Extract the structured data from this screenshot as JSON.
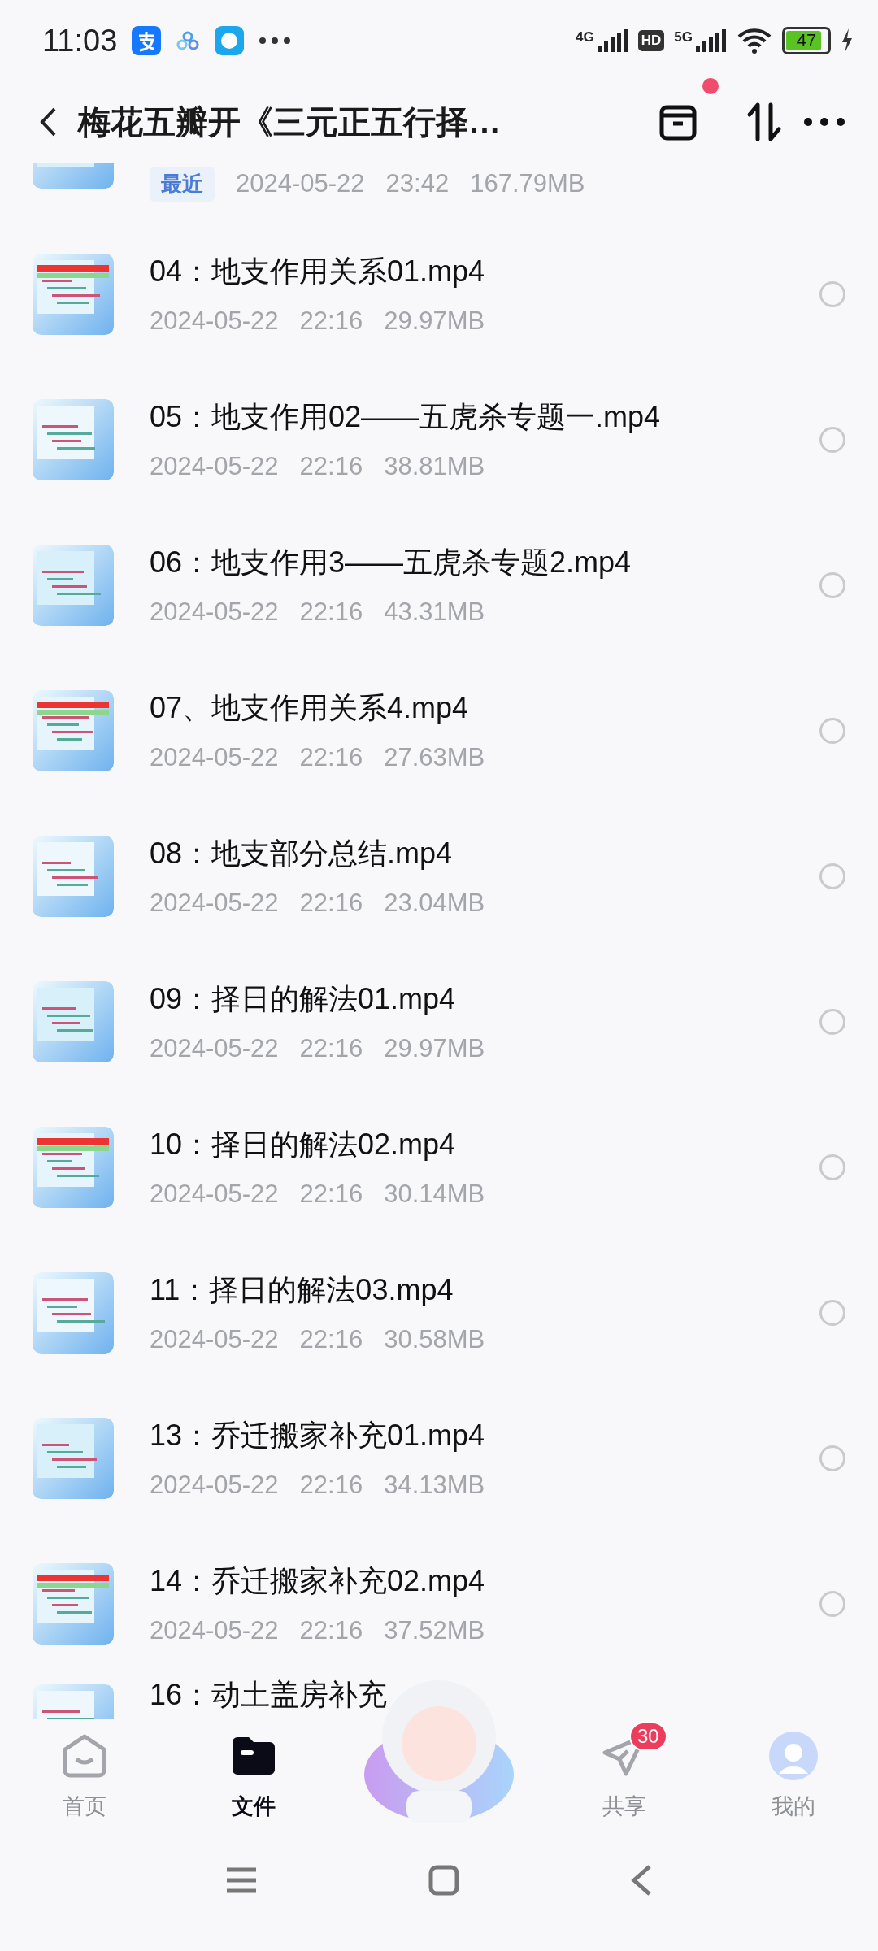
{
  "status_bar": {
    "time": "11:03",
    "network_1": "4G",
    "hd": "HD",
    "network_2": "5G",
    "battery": "47"
  },
  "header": {
    "title": "梅花五瓣开《三元正五行择…",
    "archive_badge": true
  },
  "files": [
    {
      "kind": "partial",
      "tag": "最近",
      "date": "2024-05-22",
      "time": "23:42",
      "size": "167.79MB"
    },
    {
      "kind": "file",
      "name": "04：地支作用关系01.mp4",
      "date": "2024-05-22",
      "time": "22:16",
      "size": "29.97MB",
      "selected": false
    },
    {
      "kind": "file",
      "name": "05：地支作用02——五虎杀专题一.mp4",
      "date": "2024-05-22",
      "time": "22:16",
      "size": "38.81MB",
      "selected": false
    },
    {
      "kind": "file",
      "name": "06：地支作用3——五虎杀专题2.mp4",
      "date": "2024-05-22",
      "time": "22:16",
      "size": "43.31MB",
      "selected": false
    },
    {
      "kind": "file",
      "name": "07、地支作用关系4.mp4",
      "date": "2024-05-22",
      "time": "22:16",
      "size": "27.63MB",
      "selected": false
    },
    {
      "kind": "file",
      "name": "08：地支部分总结.mp4",
      "date": "2024-05-22",
      "time": "22:16",
      "size": "23.04MB",
      "selected": false
    },
    {
      "kind": "file",
      "name": "09：择日的解法01.mp4",
      "date": "2024-05-22",
      "time": "22:16",
      "size": "29.97MB",
      "selected": false
    },
    {
      "kind": "file",
      "name": "10：择日的解法02.mp4",
      "date": "2024-05-22",
      "time": "22:16",
      "size": "30.14MB",
      "selected": false
    },
    {
      "kind": "file",
      "name": "11：择日的解法03.mp4",
      "date": "2024-05-22",
      "time": "22:16",
      "size": "30.58MB",
      "selected": false
    },
    {
      "kind": "file",
      "name": "13：乔迁搬家补充01.mp4",
      "date": "2024-05-22",
      "time": "22:16",
      "size": "34.13MB",
      "selected": false
    },
    {
      "kind": "file",
      "name": "14：乔迁搬家补充02.mp4",
      "date": "2024-05-22",
      "time": "22:16",
      "size": "37.52MB",
      "selected": false
    },
    {
      "kind": "cut",
      "name": "16：动土盖房补充"
    }
  ],
  "tab_bar": [
    {
      "kind": "home",
      "label": "首页",
      "selected": false
    },
    {
      "kind": "files",
      "label": "文件",
      "selected": true
    },
    {
      "kind": "mascot"
    },
    {
      "kind": "share",
      "label": "共享",
      "selected": false,
      "badge": "30"
    },
    {
      "kind": "me",
      "label": "我的",
      "selected": false
    }
  ]
}
